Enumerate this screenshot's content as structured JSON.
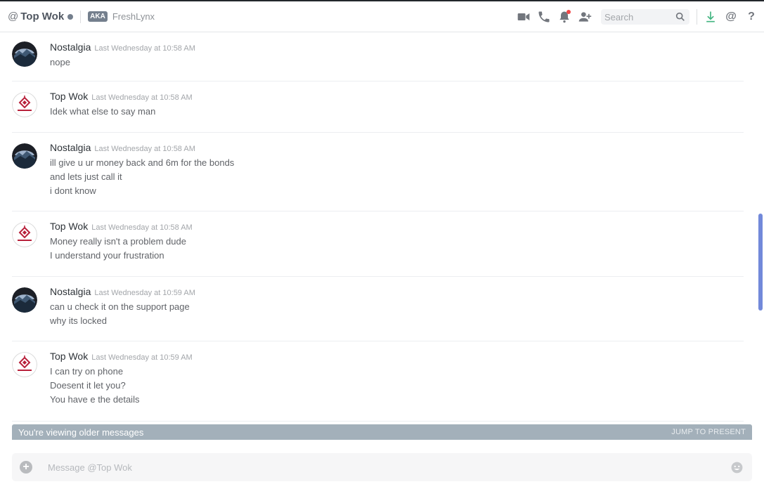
{
  "header": {
    "at_symbol": "@",
    "title": "Top Wok",
    "aka_label": "AKA",
    "nickname": "FreshLynx",
    "search_placeholder": "Search",
    "icons": [
      "video-call-icon",
      "voice-call-icon",
      "notification-bell-icon",
      "add-friend-icon",
      "search-icon",
      "download-icon",
      "mention-icon",
      "help-icon"
    ]
  },
  "messages": [
    {
      "author": "Nostalgia",
      "timestamp": "Last Wednesday at 10:58 AM",
      "lines": [
        "nope"
      ]
    },
    {
      "author": "Top Wok",
      "timestamp": "Last Wednesday at 10:58 AM",
      "lines": [
        "Idek what else to say man"
      ]
    },
    {
      "author": "Nostalgia",
      "timestamp": "Last Wednesday at 10:58 AM",
      "lines": [
        "ill give u ur money back and 6m for the bonds",
        "and lets just call it",
        "i dont know"
      ]
    },
    {
      "author": "Top Wok",
      "timestamp": "Last Wednesday at 10:58 AM",
      "lines": [
        "Money really isn't a problem dude",
        "I understand your frustration"
      ]
    },
    {
      "author": "Nostalgia",
      "timestamp": "Last Wednesday at 10:59 AM",
      "lines": [
        "can u check it on the support page",
        "why its locked"
      ]
    },
    {
      "author": "Top Wok",
      "timestamp": "Last Wednesday at 10:59 AM",
      "lines": [
        "I can try on phone",
        "Doesent it let you?",
        "You have e the details"
      ]
    }
  ],
  "older_bar": {
    "text": "You're viewing older messages",
    "jump_label": "JUMP TO PRESENT"
  },
  "composer": {
    "placeholder": "Message @Top Wok"
  },
  "colors": {
    "accent": "#7289da",
    "older_bar": "#a3b0ba",
    "notification": "#f04747",
    "download": "#43b581"
  }
}
